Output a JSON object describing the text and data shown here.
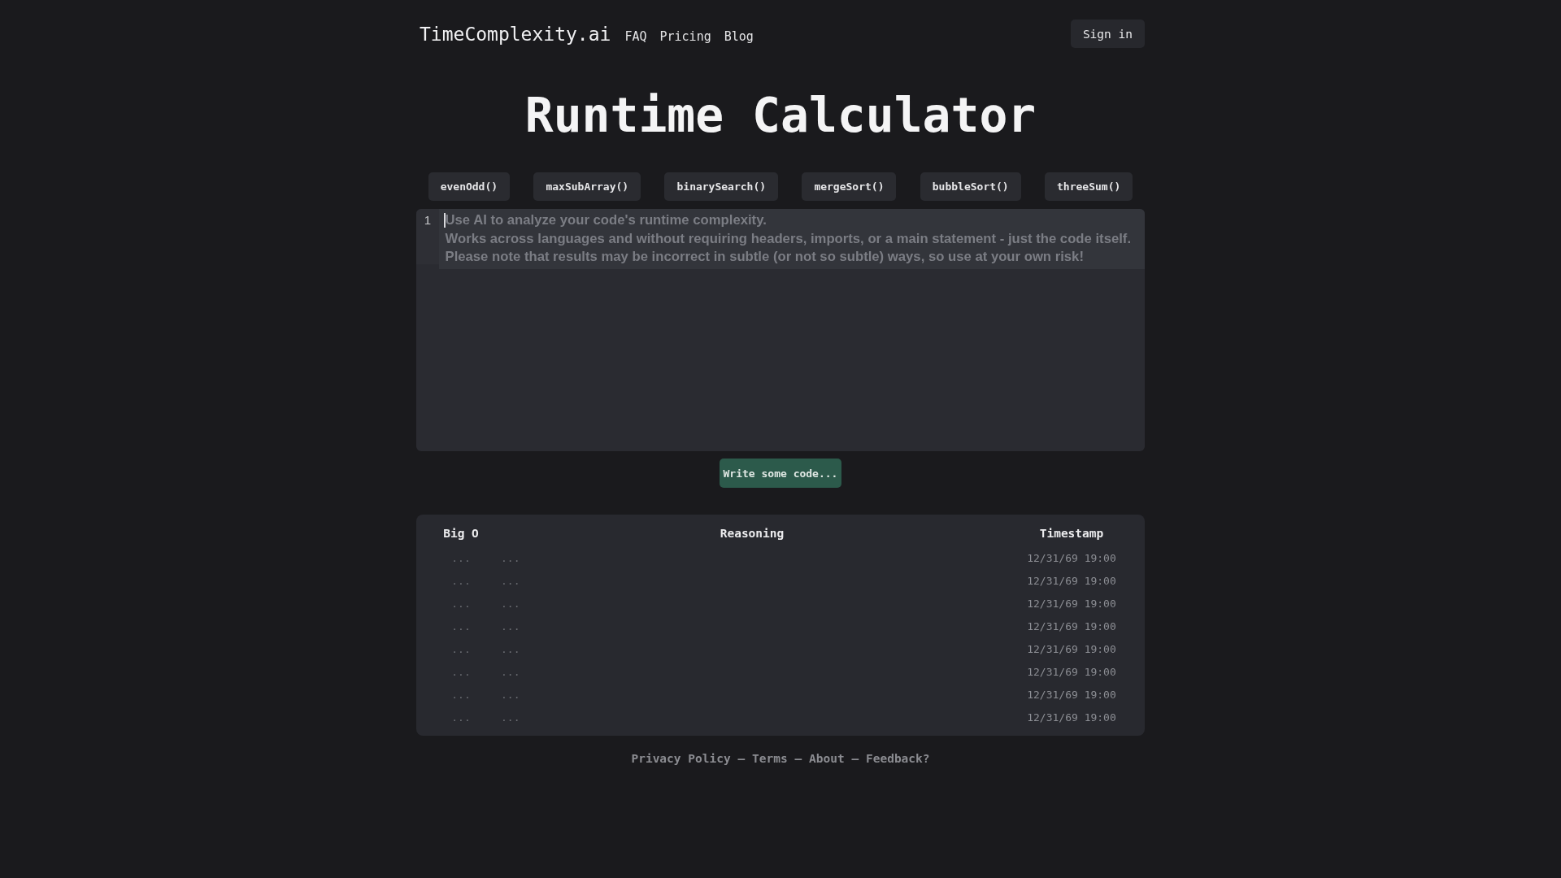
{
  "header": {
    "logo": "TimeComplexity.ai",
    "nav": [
      "FAQ",
      "Pricing",
      "Blog"
    ],
    "sign_in_button": "Sign in"
  },
  "title": "Runtime Calculator",
  "example_buttons": [
    "evenOdd()",
    "maxSubArray()",
    "binarySearch()",
    "mergeSort()",
    "bubbleSort()",
    "threeSum()"
  ],
  "editor": {
    "line_numbers": [
      "1"
    ],
    "placeholder": "Use AI to analyze your code's runtime complexity.\nWorks across languages and without requiring headers, imports, or a main statement - just the code itself.\nPlease note that results may be incorrect in subtle (or not so subtle) ways, so use at your own risk!"
  },
  "submit_button": "Write some code...",
  "table": {
    "columns": [
      "Big O",
      "Reasoning",
      "Timestamp"
    ],
    "rows": [
      {
        "cells": [
          "...",
          "...",
          "12/31/69 19:00"
        ]
      },
      {
        "cells": [
          "...",
          "...",
          "12/31/69 19:00"
        ]
      },
      {
        "cells": [
          "...",
          "...",
          "12/31/69 19:00"
        ]
      },
      {
        "cells": [
          "...",
          "...",
          "12/31/69 19:00"
        ]
      },
      {
        "cells": [
          "...",
          "...",
          "12/31/69 19:00"
        ]
      },
      {
        "cells": [
          "...",
          "...",
          "12/31/69 19:00"
        ]
      },
      {
        "cells": [
          "...",
          "...",
          "12/31/69 19:00"
        ]
      },
      {
        "cells": [
          "...",
          "...",
          "12/31/69 19:00"
        ]
      }
    ]
  },
  "footer": {
    "links": [
      "Privacy Policy",
      "Terms",
      "About",
      "Feedback?"
    ],
    "separators": [
      "–",
      "–",
      "–"
    ]
  }
}
